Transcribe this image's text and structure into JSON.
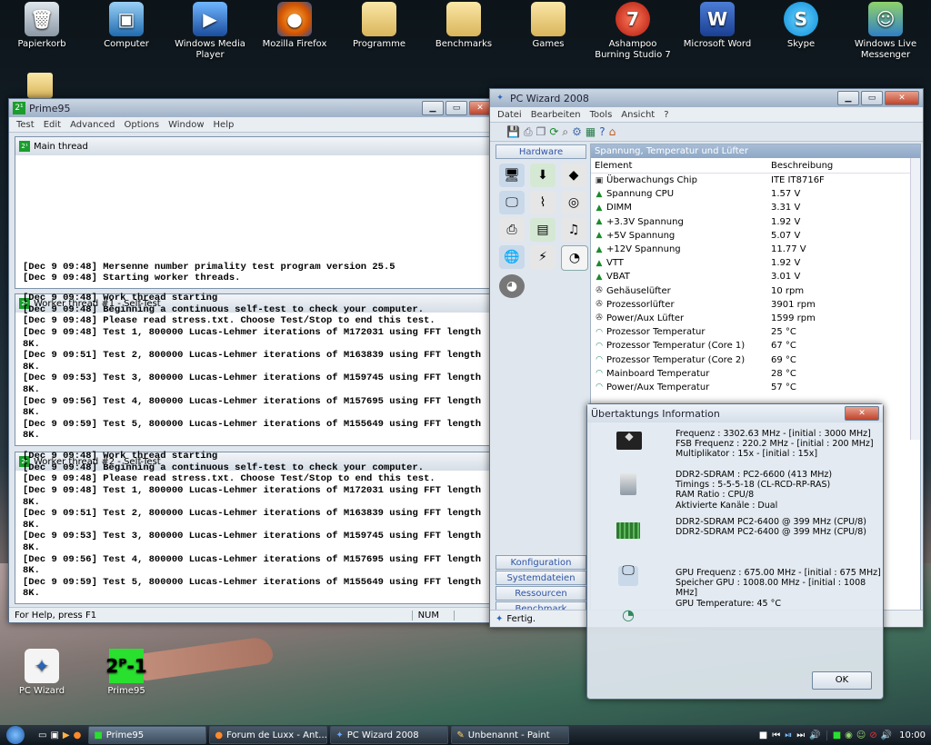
{
  "desktop": {
    "icons": [
      {
        "label": "Papierkorb",
        "icon": "recycle-bin-icon"
      },
      {
        "label": "Computer",
        "icon": "computer-icon"
      },
      {
        "label": "Windows Media Player",
        "icon": "media-player-icon"
      },
      {
        "label": "Mozilla Firefox",
        "icon": "firefox-icon"
      },
      {
        "label": "Programme",
        "icon": "folder-icon"
      },
      {
        "label": "Benchmarks",
        "icon": "folder-icon"
      },
      {
        "label": "Games",
        "icon": "folder-icon"
      },
      {
        "label": "Ashampoo Burning Studio 7",
        "icon": "burning-studio-icon"
      },
      {
        "label": "Microsoft Word",
        "icon": "word-icon"
      },
      {
        "label": "Skype",
        "icon": "skype-icon"
      },
      {
        "label": "Windows Live Messenger",
        "icon": "messenger-icon"
      },
      {
        "label": "PC Wizard",
        "icon": "pc-wizard-icon"
      },
      {
        "label": "Prime95",
        "icon": "prime95-icon"
      }
    ]
  },
  "prime95": {
    "title": "Prime95",
    "menu": [
      "Test",
      "Edit",
      "Advanced",
      "Options",
      "Window",
      "Help"
    ],
    "main_thread": {
      "title": "Main thread",
      "lines": [
        "[Dec 9 09:48] Mersenne number primality test program version 25.5",
        "[Dec 9 09:48] Starting worker threads."
      ]
    },
    "worker1": {
      "title": "Worker thread #1 - Self-Test",
      "lines": [
        "[Dec 9 09:48] Work thread starting",
        "[Dec 9 09:48] Beginning a continuous self-test to check your computer.",
        "[Dec 9 09:48] Please read stress.txt.  Choose Test/Stop to end this test.",
        "[Dec 9 09:48] Test 1, 800000 Lucas-Lehmer iterations of M172031 using FFT length 8K.",
        "[Dec 9 09:51] Test 2, 800000 Lucas-Lehmer iterations of M163839 using FFT length 8K.",
        "[Dec 9 09:53] Test 3, 800000 Lucas-Lehmer iterations of M159745 using FFT length 8K.",
        "[Dec 9 09:56] Test 4, 800000 Lucas-Lehmer iterations of M157695 using FFT length 8K.",
        "[Dec 9 09:59] Test 5, 800000 Lucas-Lehmer iterations of M155649 using FFT length 8K."
      ]
    },
    "worker2": {
      "title": "Worker thread #2 - Self-Test",
      "lines": [
        "[Dec 9 09:48] Work thread starting",
        "[Dec 9 09:48] Beginning a continuous self-test to check your computer.",
        "[Dec 9 09:48] Please read stress.txt.  Choose Test/Stop to end this test.",
        "[Dec 9 09:48] Test 1, 800000 Lucas-Lehmer iterations of M172031 using FFT length 8K.",
        "[Dec 9 09:51] Test 2, 800000 Lucas-Lehmer iterations of M163839 using FFT length 8K.",
        "[Dec 9 09:53] Test 3, 800000 Lucas-Lehmer iterations of M159745 using FFT length 8K.",
        "[Dec 9 09:56] Test 4, 800000 Lucas-Lehmer iterations of M157695 using FFT length 8K.",
        "[Dec 9 09:59] Test 5, 800000 Lucas-Lehmer iterations of M155649 using FFT length 8K."
      ]
    },
    "status_left": "For Help, press F1",
    "status_num": "NUM"
  },
  "pcwizard": {
    "title": "PC Wizard 2008",
    "menu": [
      "Datei",
      "Bearbeiten",
      "Tools",
      "Ansicht",
      "?"
    ],
    "hardware_label": "Hardware",
    "pane_title": "Spannung, Temperatur und Lüfter",
    "col_element": "Element",
    "col_desc": "Beschreibung",
    "rows": [
      {
        "name": "Überwachungs Chip",
        "value": "ITE IT8716F",
        "icon": "chip-icon"
      },
      {
        "name": "Spannung CPU",
        "value": "1.57 V",
        "icon": "voltage-icon"
      },
      {
        "name": "DIMM",
        "value": "3.31 V",
        "icon": "voltage-icon"
      },
      {
        "name": "+3.3V Spannung",
        "value": "1.92 V",
        "icon": "voltage-icon"
      },
      {
        "name": "+5V Spannung",
        "value": "5.07 V",
        "icon": "voltage-icon"
      },
      {
        "name": "+12V Spannung",
        "value": "11.77 V",
        "icon": "voltage-icon"
      },
      {
        "name": "VTT",
        "value": "1.92 V",
        "icon": "voltage-icon"
      },
      {
        "name": "VBAT",
        "value": "3.01 V",
        "icon": "voltage-icon"
      },
      {
        "name": "Gehäuselüfter",
        "value": "10 rpm",
        "icon": "fan-icon"
      },
      {
        "name": "Prozessorlüfter",
        "value": "3901 rpm",
        "icon": "fan-icon"
      },
      {
        "name": "Power/Aux Lüfter",
        "value": "1599 rpm",
        "icon": "fan-icon"
      },
      {
        "name": "Prozessor Temperatur",
        "value": "25 °C",
        "icon": "temperature-icon"
      },
      {
        "name": "Prozessor Temperatur (Core 1)",
        "value": "67 °C",
        "icon": "temperature-icon"
      },
      {
        "name": "Prozessor Temperatur (Core 2)",
        "value": "69 °C",
        "icon": "temperature-icon"
      },
      {
        "name": "Mainboard Temperatur",
        "value": "28 °C",
        "icon": "temperature-icon"
      },
      {
        "name": "Power/Aux Temperatur",
        "value": "57 °C",
        "icon": "temperature-icon"
      }
    ],
    "side_buttons": [
      "Konfiguration",
      "Systemdateien",
      "Ressourcen",
      "Benchmark"
    ],
    "status": "Fertig."
  },
  "overclock": {
    "title": "Übertaktungs Information",
    "cpu_lines": [
      "Frequenz : 3302.63 MHz  -  [initial : 3000 MHz]",
      "FSB Frequenz : 220.2 MHz  -  [initial : 200 MHz]",
      "Multiplikator : 15x  -  [initial : 15x]"
    ],
    "ram_lines": [
      "DDR2-SDRAM : PC2-6600 (413 MHz)",
      "Timings : 5-5-5-18 (CL-RCD-RP-RAS)",
      "RAM Ratio : CPU/8",
      "Aktivierte Kanäle : Dual"
    ],
    "dimm_lines": [
      "DDR2-SDRAM PC2-6400 @ 399 MHz (CPU/8)",
      "DDR2-SDRAM PC2-6400 @ 399 MHz (CPU/8)"
    ],
    "gpu_lines": [
      "GPU Frequenz : 675.00 MHz  -  [initial : 675 MHz]",
      "Speicher GPU : 1008.00 MHz  -  [initial : 1008 MHz]",
      "GPU Temperature: 45 °C"
    ],
    "ok_label": "OK"
  },
  "taskbar": {
    "items": [
      "Prime95",
      "Forum de Luxx - Ant...",
      "PC Wizard 2008",
      "Unbenannt - Paint"
    ],
    "clock": "10:00"
  }
}
